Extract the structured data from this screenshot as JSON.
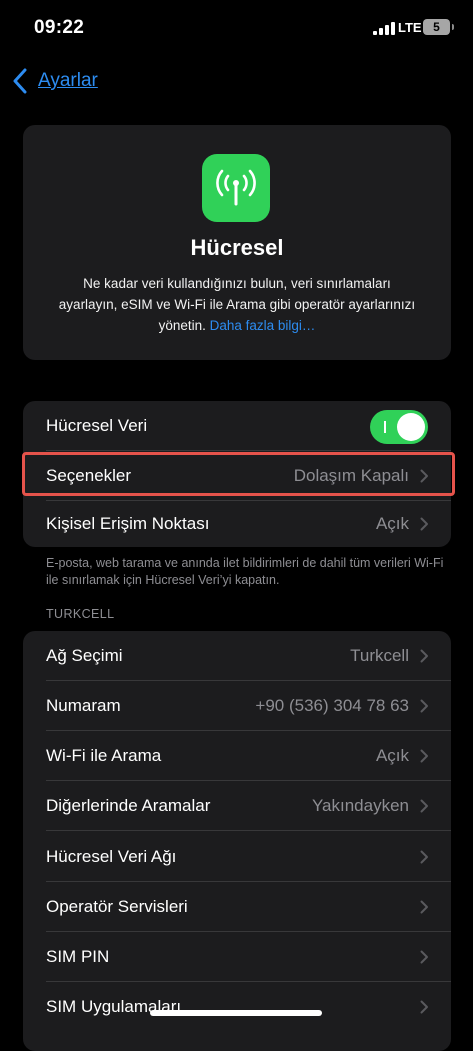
{
  "status": {
    "time": "09:22",
    "network": "LTE",
    "battery": "5"
  },
  "nav": {
    "back_label": "Ayarlar"
  },
  "hero": {
    "title": "Hücresel",
    "description": "Ne kadar veri kullandığınızı bulun, veri sınırlamaları ayarlayın, eSIM ve Wi-Fi ile Arama gibi operatör ayarlarınızı yönetin.",
    "link": "Daha fazla bilgi…",
    "icon": "antenna-icon"
  },
  "group1": {
    "rows": [
      {
        "label": "Hücresel Veri",
        "toggle": true
      },
      {
        "label": "Seçenekler",
        "value": "Dolaşım Kapalı"
      },
      {
        "label": "Kişisel Erişim Noktası",
        "value": "Açık"
      }
    ],
    "footnote": "E-posta, web tarama ve anında ilet bildirimleri de dahil tüm verileri Wi-Fi ile sınırlamak için Hücresel Veri’yi kapatın."
  },
  "carrier": {
    "header": "TURKCELL",
    "rows": [
      {
        "label": "Ağ Seçimi",
        "value": "Turkcell"
      },
      {
        "label": "Numaram",
        "value": "+90 (536) 304 78 63"
      },
      {
        "label": "Wi-Fi ile Arama",
        "value": "Açık"
      },
      {
        "label": "Diğerlerinde Aramalar",
        "value": "Yakındayken"
      },
      {
        "label": "Hücresel Veri Ağı",
        "value": ""
      },
      {
        "label": "Operatör Servisleri",
        "value": ""
      },
      {
        "label": "SIM PIN",
        "value": ""
      },
      {
        "label": "SIM Uygulamaları",
        "value": ""
      }
    ]
  },
  "colors": {
    "accent": "#2d8cf0",
    "toggle_on": "#30d158",
    "highlight": "#e5534b"
  }
}
